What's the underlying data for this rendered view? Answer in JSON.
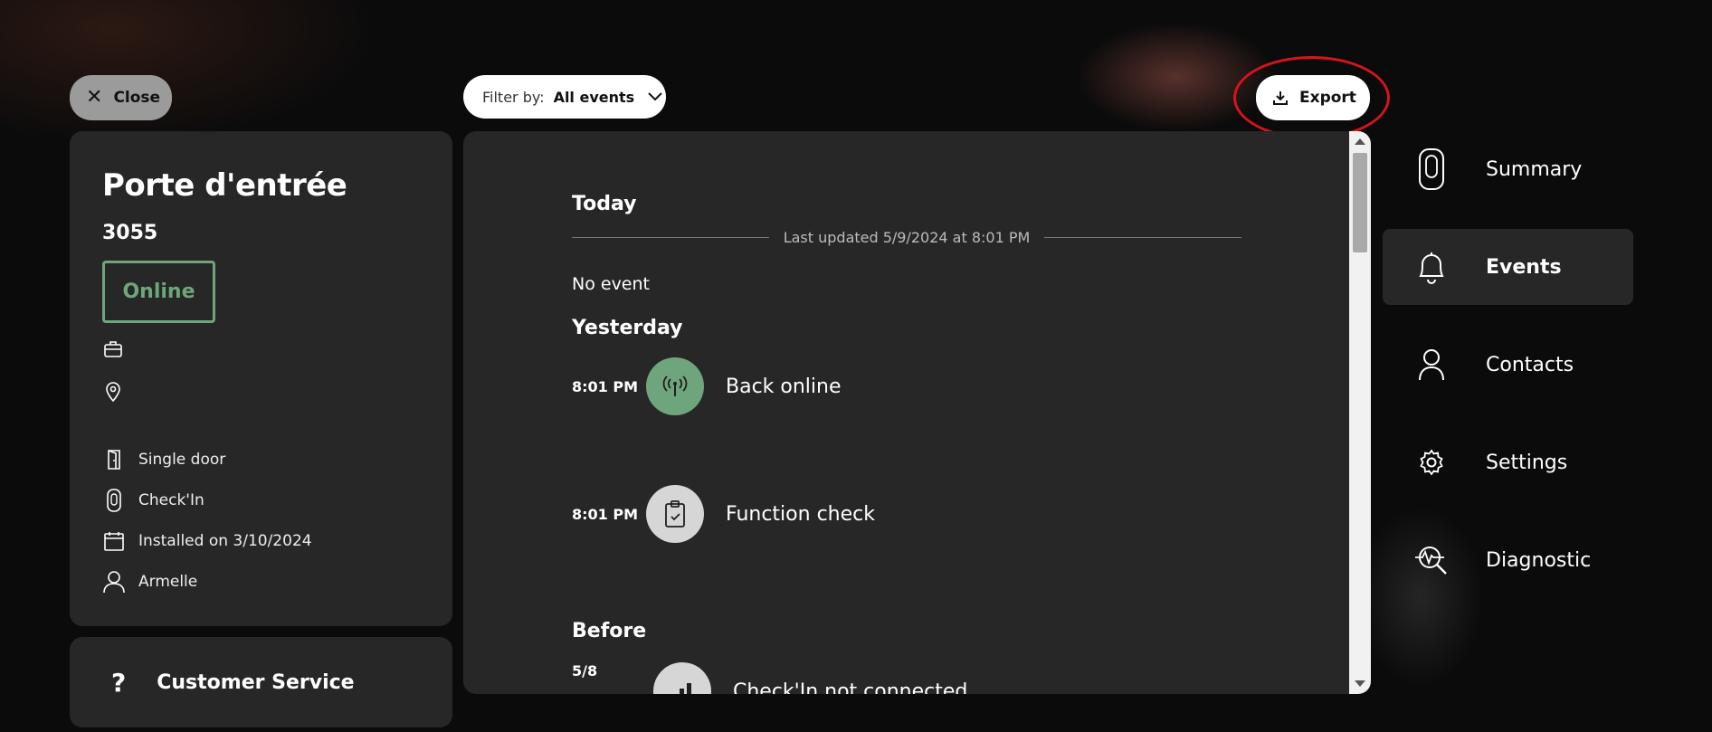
{
  "toolbar": {
    "close_label": "Close",
    "filter_label": "Filter by:",
    "filter_value": "All events",
    "export_label": "Export"
  },
  "device": {
    "title": "Porte d'entrée",
    "id": "3055",
    "status": "Online",
    "details": [
      {
        "icon": "door-icon",
        "text": "Single door"
      },
      {
        "icon": "device-icon",
        "text": "Check'In"
      },
      {
        "icon": "calendar-icon",
        "text": "Installed on 3/10/2024"
      },
      {
        "icon": "person-icon",
        "text": "Armelle"
      }
    ]
  },
  "service": {
    "icon_text": "?",
    "label": "Customer Service"
  },
  "events": {
    "today_label": "Today",
    "last_updated": "Last updated 5/9/2024 at 8:01 PM",
    "no_event": "No event",
    "yesterday_label": "Yesterday",
    "before_label": "Before",
    "yesterday_items": [
      {
        "time": "8:01 PM",
        "name": "Back online",
        "icon": "signal-icon",
        "color": "#6fa57d"
      },
      {
        "time": "8:01 PM",
        "name": "Function check",
        "icon": "clipboard-check-icon",
        "color": "#d6d6d6"
      }
    ],
    "before_items": [
      {
        "time": "5/8",
        "name": "Check'In not connected",
        "icon": "bars-icon",
        "color": "#d6d6d6"
      }
    ]
  },
  "nav": {
    "items": [
      {
        "label": "Summary",
        "icon": "device-icon"
      },
      {
        "label": "Events",
        "icon": "bell-icon",
        "active": true
      },
      {
        "label": "Contacts",
        "icon": "person-icon"
      },
      {
        "label": "Settings",
        "icon": "gear-icon"
      },
      {
        "label": "Diagnostic",
        "icon": "diagnostic-icon"
      }
    ]
  }
}
